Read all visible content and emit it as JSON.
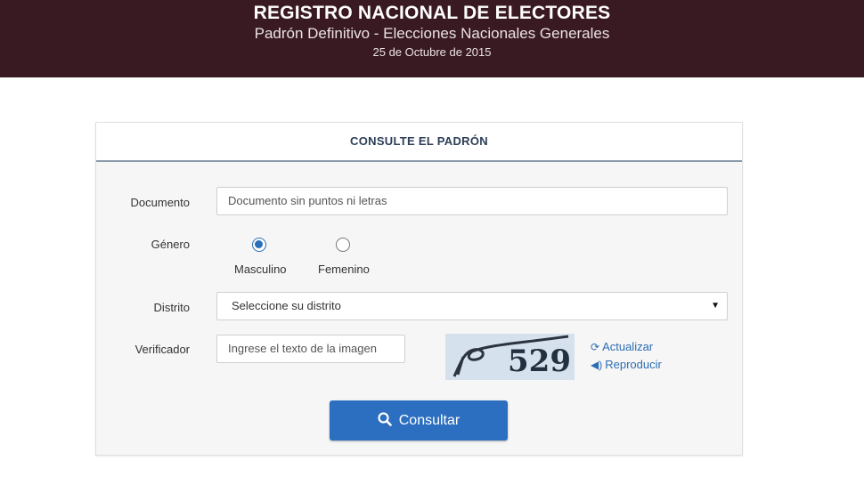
{
  "header": {
    "title": "REGISTRO NACIONAL DE ELECTORES",
    "subtitle": "Padrón Definitivo - Elecciones Nacionales Generales",
    "date": "25 de Octubre de 2015"
  },
  "panel": {
    "title": "CONSULTE EL PADRÓN"
  },
  "form": {
    "documento": {
      "label": "Documento",
      "placeholder": "Documento sin puntos ni letras",
      "value": ""
    },
    "genero": {
      "label": "Género",
      "options": [
        "Masculino",
        "Femenino"
      ],
      "selected": "Masculino"
    },
    "distrito": {
      "label": "Distrito",
      "selected_text": "Seleccione su distrito"
    },
    "verificador": {
      "label": "Verificador",
      "placeholder": "Ingrese el texto de la imagen",
      "captcha_text": "529",
      "refresh_label": "Actualizar",
      "audio_label": "Reproducir"
    },
    "submit_label": "Consultar"
  },
  "colors": {
    "header_bg": "#3a1a22",
    "accent": "#2c6fc0",
    "link": "#2d6db5"
  }
}
